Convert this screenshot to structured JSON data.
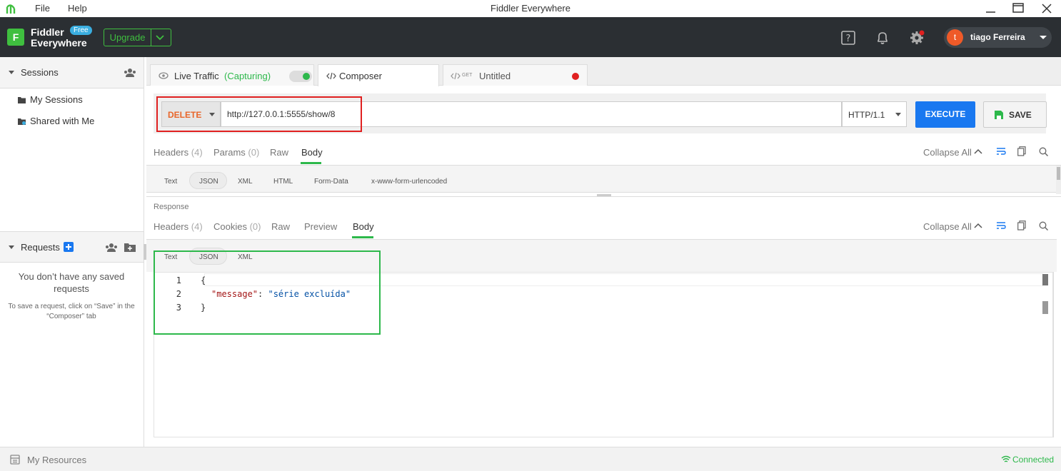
{
  "window": {
    "title": "Fiddler Everywhere",
    "menu": [
      "File",
      "Help"
    ]
  },
  "header": {
    "brand_line1": "Fiddler",
    "brand_line2": "Everywhere",
    "badge": "Free",
    "upgrade_label": "Upgrade",
    "user_initial": "t",
    "user_name": "tiago Ferreira"
  },
  "sidebar": {
    "sessions_title": "Sessions",
    "sessions_items": [
      "My Sessions",
      "Shared with Me"
    ],
    "requests_title": "Requests",
    "no_requests": "You don’t have any saved requests",
    "no_requests_hint": "To save a request, click on “Save” in the “Composer” tab"
  },
  "tabs": {
    "live_traffic": "Live Traffic",
    "capturing": "(Capturing)",
    "composer": "Composer",
    "untitled_method": "GET",
    "untitled": "Untitled"
  },
  "request": {
    "method": "DELETE",
    "url": "http://127.0.0.1:5555/show/8",
    "http_version": "HTTP/1.1",
    "execute_label": "EXECUTE",
    "save_label": "SAVE",
    "subtabs": [
      "Headers",
      "(4)",
      "Params",
      "(0)",
      "Raw",
      "Body"
    ],
    "collapse_all": "Collapse All",
    "formats": [
      "Text",
      "JSON",
      "XML",
      "HTML",
      "Form-Data",
      "x-www-form-urlencoded"
    ]
  },
  "response": {
    "section_label": "Response",
    "subtabs": [
      "Headers",
      "(4)",
      "Cookies",
      "(0)",
      "Raw",
      "Preview",
      "Body"
    ],
    "collapse_all": "Collapse All",
    "formats": [
      "Text",
      "JSON",
      "XML"
    ],
    "line_numbers": [
      "1",
      "2",
      "3"
    ],
    "code": {
      "open": "{",
      "key": "\"message\"",
      "sep": ": ",
      "value": "\"série excluída\"",
      "close": "}"
    }
  },
  "statusbar": {
    "resources": "My Resources",
    "connection": "Connected"
  },
  "colors": {
    "header_bg": "#2b2f33",
    "accent_green": "#2db84b",
    "execute_blue": "#1978f0",
    "method_orange": "#e8662a",
    "highlight_red": "#e02020"
  }
}
